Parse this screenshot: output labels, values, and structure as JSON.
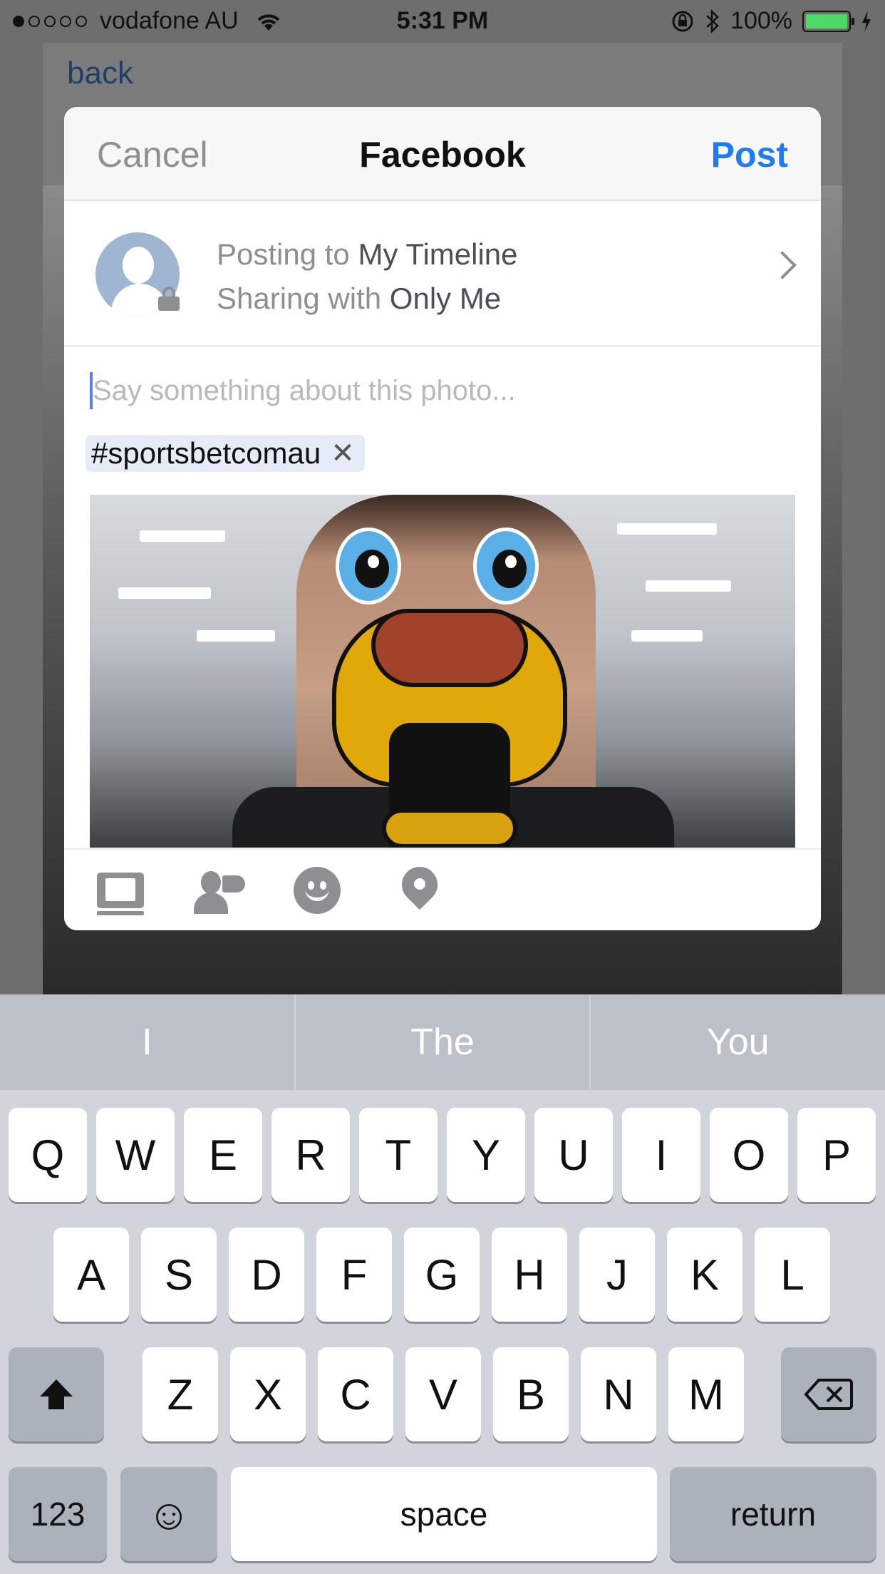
{
  "status_bar": {
    "carrier": "vodafone AU",
    "time": "5:31 PM",
    "battery": "100%",
    "signal_bars": 1
  },
  "background": {
    "back_label": "back"
  },
  "share_sheet": {
    "cancel_label": "Cancel",
    "title": "Facebook",
    "post_label": "Post",
    "posting_prefix": "Posting to ",
    "posting_target": "My Timeline",
    "sharing_prefix": "Sharing with ",
    "sharing_target": "Only Me",
    "caption_placeholder": "Say something about this photo...",
    "hashtag": "#sportsbetcomau",
    "hashtag_remove": "✕",
    "toolbar_icons": [
      "photo-album-icon",
      "tag-people-icon",
      "feeling-icon",
      "location-pin-icon"
    ]
  },
  "keyboard": {
    "suggestions": [
      "I",
      "The",
      "You"
    ],
    "row1": [
      "Q",
      "W",
      "E",
      "R",
      "T",
      "Y",
      "U",
      "I",
      "O",
      "P"
    ],
    "row2": [
      "A",
      "S",
      "D",
      "F",
      "G",
      "H",
      "J",
      "K",
      "L"
    ],
    "row3": [
      "Z",
      "X",
      "C",
      "V",
      "B",
      "N",
      "M"
    ],
    "numbers_label": "123",
    "emoji_label": "☺",
    "space_label": "space",
    "return_label": "return"
  },
  "colors": {
    "accent": "#1d7cf2",
    "battery": "#4cd964"
  }
}
